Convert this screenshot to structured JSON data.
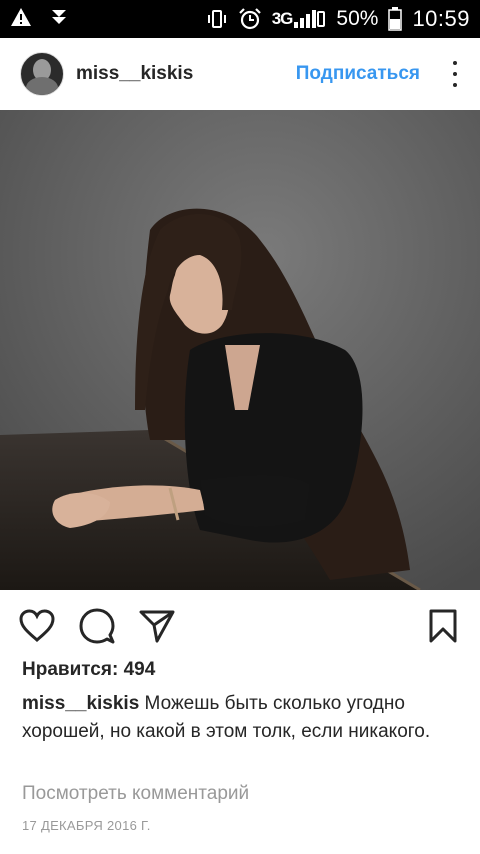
{
  "status_bar": {
    "icons_left": [
      "warning-icon",
      "download-icon"
    ],
    "network": "3G",
    "battery_percent": "50%",
    "time": "10:59"
  },
  "post": {
    "username": "miss__kiskis",
    "follow_label": "Подписаться",
    "likes": "Нравится: 494",
    "caption_user": "miss__kiskis",
    "caption_text": " Можешь быть сколько угодно хорошей, но какой в этом толк, если никакого.",
    "view_comments": "Посмотреть комментарий",
    "date": "17 ДЕКАБРЯ 2016 Г."
  },
  "actions": {
    "icons": [
      "heart-icon",
      "comment-icon",
      "share-icon",
      "bookmark-icon"
    ]
  },
  "colors": {
    "accent": "#3897f0",
    "text": "#262626",
    "muted": "#999999",
    "status_bar_bg": "#000000"
  }
}
